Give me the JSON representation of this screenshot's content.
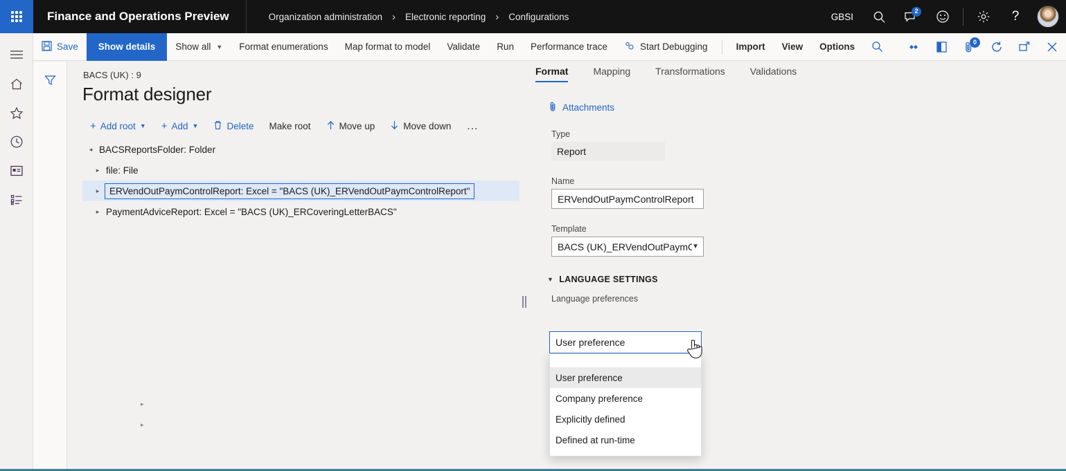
{
  "topbar": {
    "waffle_icon": "waffle-grid-icon",
    "brand": "Finance and Operations Preview",
    "breadcrumb": [
      "Organization administration",
      "Electronic reporting",
      "Configurations"
    ],
    "breadcrumb_sep": "›",
    "company": "GBSI",
    "search_icon": "search-icon",
    "messages_icon": "message-icon",
    "messages_badge": "2",
    "feedback_icon": "smiley-icon",
    "settings_icon": "gear-icon",
    "help_icon": "question-mark-icon",
    "avatar": "user-avatar"
  },
  "leftrail": {
    "items": [
      {
        "name": "hamburger-menu-icon",
        "label": "Menu"
      },
      {
        "name": "home-icon",
        "label": "Home"
      },
      {
        "name": "star-icon",
        "label": "Favorites"
      },
      {
        "name": "clock-icon",
        "label": "Recent"
      },
      {
        "name": "workspace-icon",
        "label": "Workspaces"
      },
      {
        "name": "modules-icon",
        "label": "Modules"
      }
    ]
  },
  "filterstrip": {
    "filter_icon": "filter-icon"
  },
  "cmdbar": {
    "save": "Save",
    "save_icon": "save-disk-icon",
    "show_details": "Show details",
    "show_all": "Show all",
    "format_enumerations": "Format enumerations",
    "map_format_to_model": "Map format to model",
    "validate": "Validate",
    "run": "Run",
    "performance_trace": "Performance trace",
    "start_debugging": "Start Debugging",
    "start_debugging_icon": "debug-gear-icon",
    "import": "Import",
    "view": "View",
    "options": "Options",
    "search_icon": "search-icon",
    "share_icon": "share-icon",
    "open_in_office_icon": "office-app-icon",
    "attach_icon": "attachment-icon",
    "attach_badge": "0",
    "refresh_icon": "refresh-icon",
    "popout_icon": "open-in-new-window-icon",
    "close_icon": "close-icon"
  },
  "page": {
    "subtitle": "BACS (UK) : 9",
    "title": "Format designer"
  },
  "treebar": {
    "add_root": "Add root",
    "add": "Add",
    "delete": "Delete",
    "make_root": "Make root",
    "move_up": "Move up",
    "move_down": "Move down",
    "overflow": "…",
    "plus_icon": "plus-icon",
    "trash_icon": "trash-icon",
    "arrow_up_icon": "arrow-up-icon",
    "arrow_down_icon": "arrow-down-icon",
    "chevron_down_icon": "chevron-down-icon"
  },
  "tree": {
    "expanded_glyph": "◂",
    "collapsed_glyph": "▸",
    "nodes": [
      {
        "label": "BACSReportsFolder: Folder",
        "level": 0,
        "expanded": true,
        "selected": false
      },
      {
        "label": "file: File",
        "level": 1,
        "expanded": false,
        "selected": false
      },
      {
        "label": "ERVendOutPaymControlReport: Excel = \"BACS (UK)_ERVendOutPaymControlReport\"",
        "level": 1,
        "expanded": false,
        "selected": true
      },
      {
        "label": "PaymentAdviceReport: Excel = \"BACS (UK)_ERCoveringLetterBACS\"",
        "level": 1,
        "expanded": false,
        "selected": false
      }
    ]
  },
  "rpanel": {
    "tabs": [
      {
        "label": "Format",
        "active": true
      },
      {
        "label": "Mapping",
        "active": false
      },
      {
        "label": "Transformations",
        "active": false
      },
      {
        "label": "Validations",
        "active": false
      }
    ],
    "attachments": "Attachments",
    "attachments_icon": "paperclip-icon",
    "fields": {
      "type_label": "Type",
      "type_value": "Report",
      "name_label": "Name",
      "name_value": "ERVendOutPaymControlReport",
      "template_label": "Template",
      "template_value": "BACS (UK)_ERVendOutPaymC...",
      "template_chevron": "chevron-down-icon"
    },
    "section": {
      "caret": "▾",
      "title": "LANGUAGE SETTINGS",
      "lang_pref_label": "Language preferences",
      "lang_pref_value": "User preference",
      "lang_pref_chevron": "chevron-down-icon"
    },
    "dropdown": {
      "options": [
        {
          "label": "User preference",
          "selected": true
        },
        {
          "label": "Company preference",
          "selected": false
        },
        {
          "label": "Explicitly defined",
          "selected": false
        },
        {
          "label": "Defined at run-time",
          "selected": false
        }
      ]
    }
  },
  "colors": {
    "brand_blue": "#2266c8",
    "topbar_black": "#141414",
    "page_bg": "#f2f1f0",
    "selection_blue": "#dfe8f7",
    "bottom_accent": "#3b7f92"
  }
}
